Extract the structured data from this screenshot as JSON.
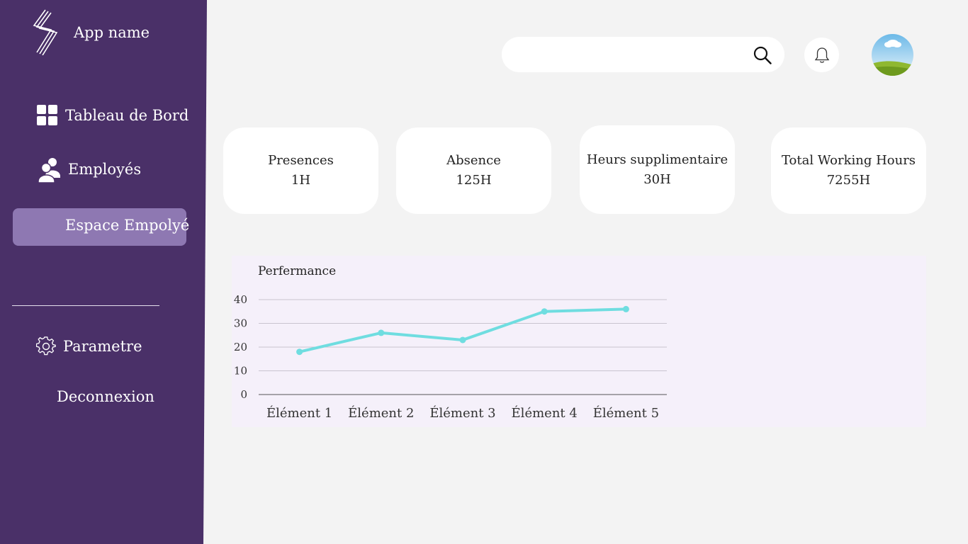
{
  "sidebar": {
    "app_name": "App name",
    "items": [
      {
        "label": "Tableau de Bord",
        "icon": "dashboard-grid-icon"
      },
      {
        "label": "Employés",
        "icon": "users-icon"
      },
      {
        "label": "Espace Empolyé",
        "icon": "",
        "active": true
      },
      {
        "label": "Parametre",
        "icon": "gear-icon"
      },
      {
        "label": "Deconnexion",
        "icon": ""
      }
    ]
  },
  "header": {
    "search": {
      "placeholder": "",
      "icon": "search-icon"
    },
    "notification_icon": "bell-icon",
    "avatar_icon": "user-avatar"
  },
  "cards": [
    {
      "title": "Presences",
      "value": "1H"
    },
    {
      "title": "Absence",
      "value": "125H"
    },
    {
      "title": "Heurs supplimentaire",
      "value": "30H"
    },
    {
      "title": "Total Working Hours",
      "value": "7255H"
    }
  ],
  "colors": {
    "sidebar": "#4a3068",
    "active_item": "#8e78b2",
    "background": "#f3f3f3",
    "line": "#6fdde0",
    "chart_panel": "#f5f0fa"
  },
  "chart_data": {
    "type": "line",
    "title": "Perfermance",
    "categories": [
      "Élément 1",
      "Élément 2",
      "Élément 3",
      "Élément 4",
      "Élément 5"
    ],
    "series": [
      {
        "values": [
          18,
          26,
          23,
          35,
          36
        ]
      }
    ],
    "yticks": [
      "0",
      "10",
      "20",
      "30",
      "40"
    ],
    "ylim": [
      0,
      40
    ],
    "grid": true,
    "xlabel": "",
    "ylabel": ""
  }
}
